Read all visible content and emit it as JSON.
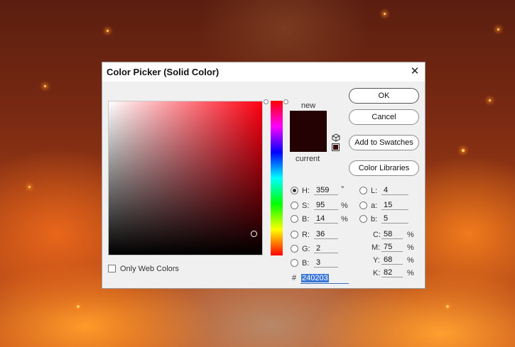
{
  "dialog": {
    "title": "Color Picker (Solid Color)",
    "close_glyph": "✕"
  },
  "swatches": {
    "new_label": "new",
    "current_label": "current",
    "new_color": "#240203",
    "current_color": "#240203"
  },
  "buttons": {
    "ok": "OK",
    "cancel": "Cancel",
    "add_to_swatches": "Add to Swatches",
    "color_libraries": "Color Libraries"
  },
  "only_web_colors": {
    "label": "Only Web Colors",
    "checked": false
  },
  "hsb": {
    "h": {
      "label": "H:",
      "value": "359",
      "unit": "°",
      "selected": true
    },
    "s": {
      "label": "S:",
      "value": "95",
      "unit": "%"
    },
    "b": {
      "label": "B:",
      "value": "14",
      "unit": "%"
    }
  },
  "rgb": {
    "r": {
      "label": "R:",
      "value": "36"
    },
    "g": {
      "label": "G:",
      "value": "2"
    },
    "b": {
      "label": "B:",
      "value": "3"
    }
  },
  "lab": {
    "l": {
      "label": "L:",
      "value": "4"
    },
    "a": {
      "label": "a:",
      "value": "15"
    },
    "b": {
      "label": "b:",
      "value": "5"
    }
  },
  "cmyk": {
    "c": {
      "label": "C:",
      "value": "58",
      "unit": "%"
    },
    "m": {
      "label": "M:",
      "value": "75",
      "unit": "%"
    },
    "y": {
      "label": "Y:",
      "value": "68",
      "unit": "%"
    },
    "k": {
      "label": "K:",
      "value": "82",
      "unit": "%"
    }
  },
  "hex": {
    "label": "#",
    "value": "240203"
  },
  "icons": {
    "gamut_warning": "cube-icon",
    "web_safe_swatch": "web-swatch-icon"
  }
}
